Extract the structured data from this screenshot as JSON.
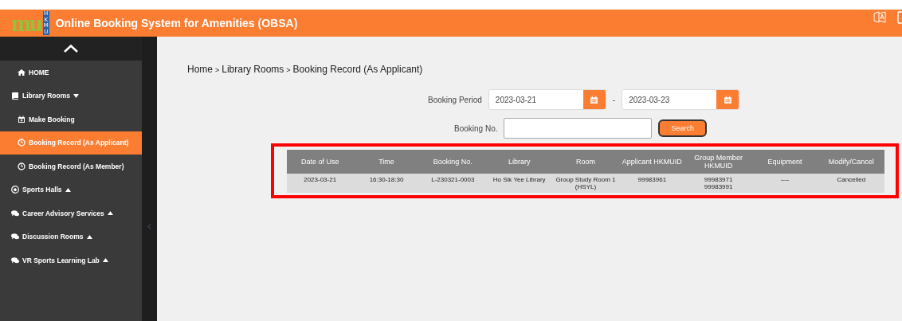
{
  "header": {
    "logo": "mu",
    "logo_tag": "HKMU",
    "title": "Online Booking System for Amenities (OBSA)"
  },
  "sidebar": {
    "items": [
      {
        "kind": "link",
        "label": "HOME",
        "selected": false
      },
      {
        "kind": "group",
        "label": "Library Rooms",
        "expanded": true,
        "children": [
          {
            "kind": "link",
            "label": "Make Booking",
            "selected": false
          },
          {
            "kind": "link",
            "label": "Booking Record (As Applicant)",
            "selected": true
          },
          {
            "kind": "link",
            "label": "Booking Record (As Member)",
            "selected": false
          }
        ]
      },
      {
        "kind": "group",
        "label": "Sports Halls",
        "expanded": false
      },
      {
        "kind": "group",
        "label": "Career Advisory Services",
        "expanded": false
      },
      {
        "kind": "group",
        "label": "Discussion Rooms",
        "expanded": false
      },
      {
        "kind": "group",
        "label": "VR Sports Learning Lab",
        "expanded": false
      }
    ]
  },
  "breadcrumb": {
    "items": [
      "Home",
      "Library Rooms",
      "Booking Record (As Applicant)"
    ],
    "separator": ">"
  },
  "form": {
    "period_label": "Booking Period",
    "date_from": "2023-03-21",
    "range_separator": "-",
    "date_to": "2023-03-23",
    "booking_no_label": "Booking No.",
    "search_button": "Search"
  },
  "table": {
    "columns": [
      "Date of Use",
      "Time",
      "Booking No.",
      "Library",
      "Room",
      "Applicant HKMUID",
      "Group Member HKMUID",
      "Equipment",
      "Modify/Cancel"
    ],
    "rows": [
      [
        "2023-03-21",
        "16:30-18:30",
        "L-230321-0003",
        "Ho Sik Yee Library",
        "Group Study Room 1 (HSYL)",
        "99983961",
        "99983971\n99983991",
        "----",
        "Cancelled"
      ]
    ]
  }
}
